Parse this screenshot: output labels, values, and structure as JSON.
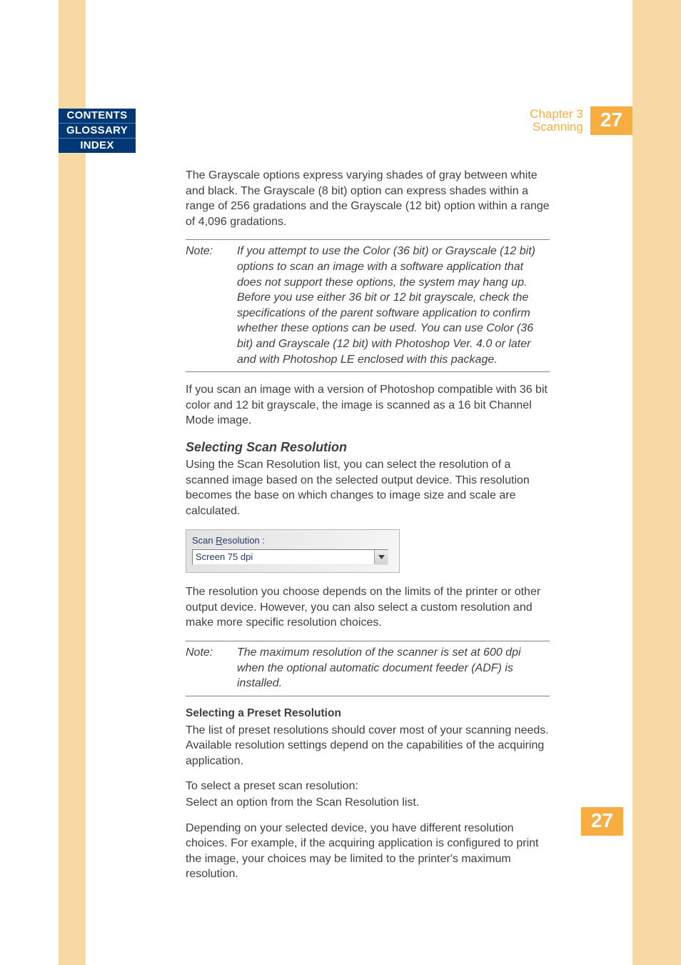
{
  "nav": {
    "contents": "CONTENTS",
    "glossary": "GLOSSARY",
    "index": "INDEX"
  },
  "header": {
    "chapter": "Chapter 3",
    "section": "Scanning",
    "page": "27"
  },
  "body": {
    "p1": "The Grayscale options express varying shades of gray between white and black. The Grayscale (8 bit) option can express shades within a range of 256 gradations and the Grayscale (12 bit) option within a range of 4,096 gradations.",
    "note1_label": "Note:",
    "note1_text": "If you attempt to use the Color (36 bit) or Grayscale (12 bit) options to scan an image with a software application that does not support these options, the system may hang up. Before you use either 36 bit or 12 bit grayscale, check the specifications of the parent software application to confirm whether these options can be used. You can use Color (36 bit) and Grayscale (12 bit) with Photoshop Ver. 4.0 or later and with Photoshop LE enclosed with this package.",
    "p2": "If you scan an image with a version of Photoshop compatible with 36 bit color and 12 bit grayscale, the image is scanned as a 16 bit Channel Mode image.",
    "h_scanres": "Selecting Scan Resolution",
    "p3": "Using the Scan Resolution list, you can select the resolution of a scanned image based on the selected output device. This resolution becomes the base on which changes to image size and scale are calculated.",
    "widget": {
      "label_prefix": "Scan ",
      "label_underline": "R",
      "label_suffix": "esolution :",
      "value": "Screen 75 dpi"
    },
    "p4": "The resolution you choose depends on the limits of the printer or other output device. However, you can also select a custom resolution and make more specific resolution choices.",
    "note2_label": "Note:",
    "note2_text": "The maximum resolution of the scanner is set at 600 dpi when the optional automatic document feeder (ADF) is installed.",
    "h_preset": "Selecting a Preset Resolution",
    "p5": "The list of preset resolutions should cover most of your scanning needs. Available resolution settings depend on the capabilities of the acquiring application.",
    "h_step": "To select a preset scan resolution:",
    "p6": "Select an option from the Scan Resolution list.",
    "p7": "Depending on your selected device, you have different resolution choices. For example, if the acquiring application is configured to print the image, your choices may be limited to the printer's maximum resolution."
  },
  "footer": {
    "page": "27"
  }
}
